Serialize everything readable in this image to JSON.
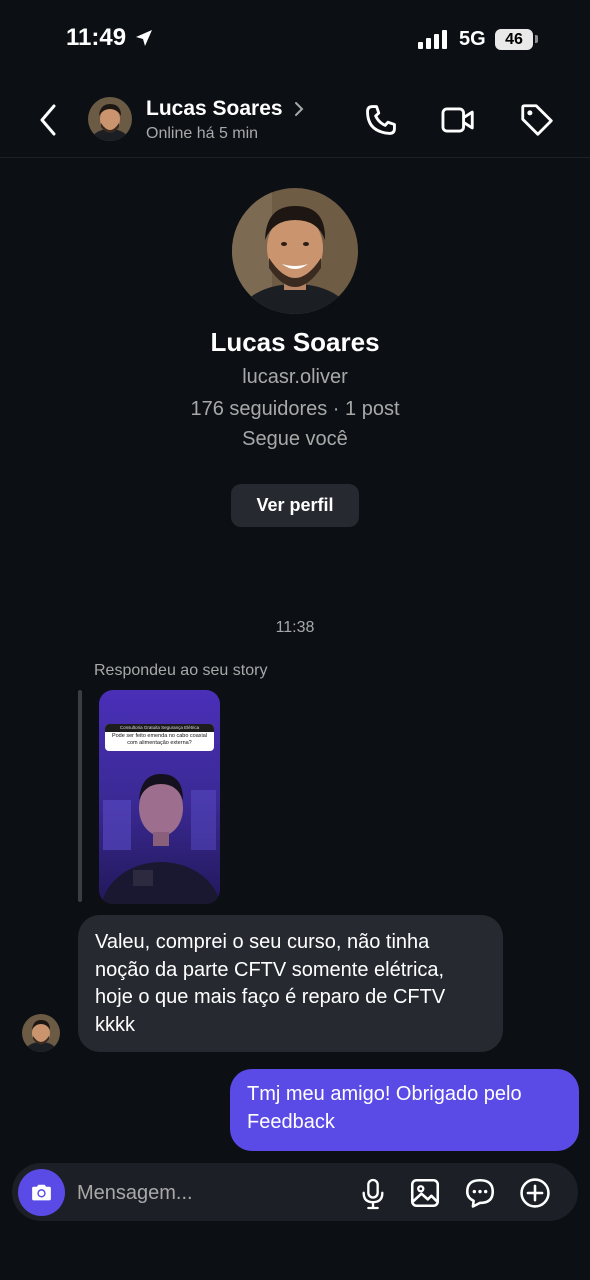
{
  "status_bar": {
    "time": "11:49",
    "network": "5G",
    "battery": "46"
  },
  "header": {
    "name": "Lucas Soares",
    "status": "Online há 5 min"
  },
  "profile": {
    "name": "Lucas Soares",
    "username": "lucasr.oliver",
    "stats": "176 seguidores · 1 post",
    "follows": "Segue você",
    "view_button": "Ver perfil"
  },
  "thread": {
    "timestamp": "11:38",
    "reply_label": "Respondeu ao seu story",
    "story": {
      "title": "Consultoria Gratuita Segurança Elétrica",
      "question": "Pode ser feito emenda no cabo coaxial com alimentação externa?"
    },
    "messages": [
      {
        "from": "them",
        "text": "Valeu, comprei o seu curso, não tinha noção da parte CFTV somente elétrica, hoje o que mais faço é reparo de CFTV kkkk"
      },
      {
        "from": "me",
        "text": "Tmj meu amigo!  Obrigado pelo Feedback"
      }
    ]
  },
  "composer": {
    "placeholder": "Mensagem..."
  },
  "colors": {
    "background": "#0c1014",
    "accent": "#5b4be6",
    "bubble_in": "#262a30"
  }
}
